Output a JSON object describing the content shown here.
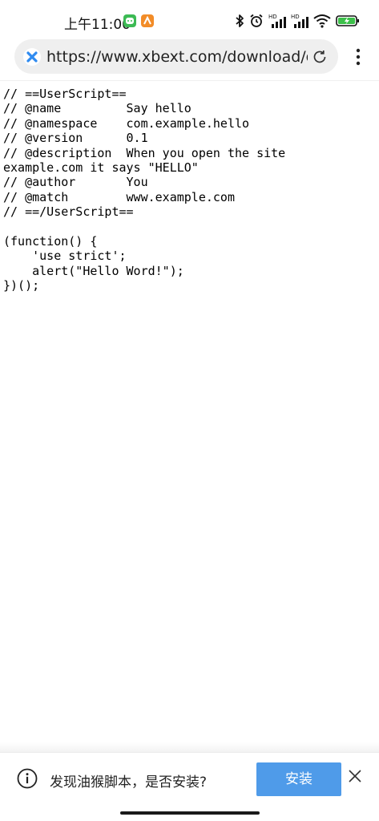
{
  "status_bar": {
    "time": "上午11:00",
    "icons": [
      "wechat-icon",
      "app-notification-icon",
      "bluetooth-icon",
      "alarm-icon",
      "signal-hd-icon",
      "signal-hd-icon",
      "wifi-icon",
      "battery-charging-icon"
    ],
    "signal_label": "HD"
  },
  "address_bar": {
    "site_icon": "x-logo-icon",
    "url": "https://www.xbext.com/download/co",
    "reload_icon": "reload-icon",
    "menu_icon": "more-vertical-icon"
  },
  "content": {
    "code": "// ==UserScript==\n// @name         Say hello\n// @namespace    com.example.hello\n// @version      0.1\n// @description  When you open the site example.com it says \"HELLO\"\n// @author       You\n// @match        www.example.com\n// ==/UserScript==\n\n(function() {\n    'use strict';\n    alert(\"Hello Word!\");\n})();"
  },
  "install_banner": {
    "info_icon": "info-icon",
    "message": "发现油猴脚本，是否安装?",
    "install_label": "安装",
    "close_icon": "close-icon"
  },
  "colors": {
    "accent": "#4f9be9",
    "address_bar_bg": "#efefef",
    "site_icon_blue": "#2f8bf0"
  }
}
